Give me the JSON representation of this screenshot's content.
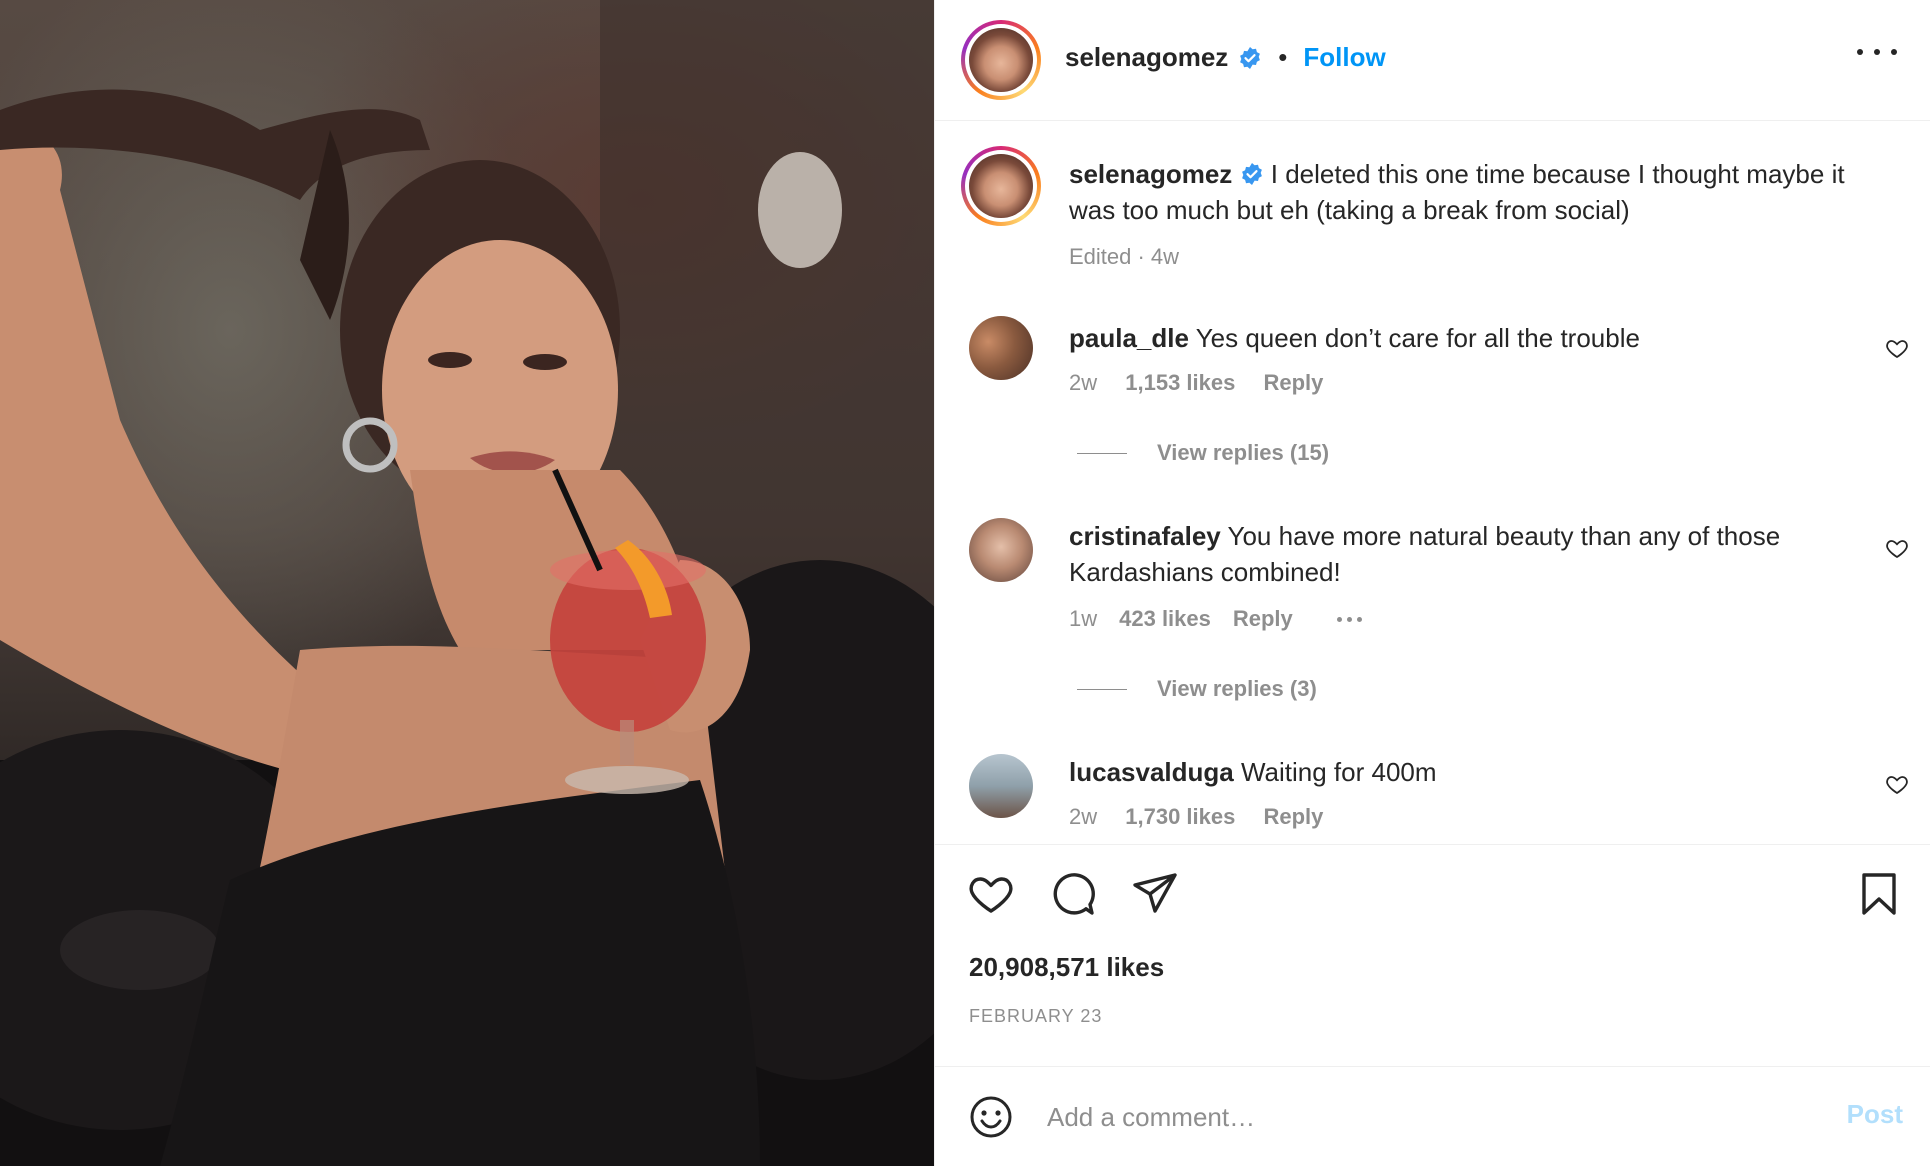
{
  "post": {
    "username": "selenagomez",
    "follow_label": "Follow",
    "separator": "•",
    "caption": "I deleted this one time because I thought maybe it was too much but eh (taking a break from social)",
    "caption_meta": "Edited · 4w"
  },
  "comments": [
    {
      "username": "paula_dle",
      "text": "Yes queen don’t care for all the trouble",
      "time": "2w",
      "likes": "1,153 likes",
      "reply_label": "Reply",
      "view_replies": "View replies (15)"
    },
    {
      "username": "cristinafaley",
      "text": "You have more natural beauty than any of those Kardashians combined!",
      "time": "1w",
      "likes": "423 likes",
      "reply_label": "Reply",
      "view_replies": "View replies (3)"
    },
    {
      "username": "lucasvalduga",
      "text": "Waiting for 400m",
      "time": "2w",
      "likes": "1,730 likes",
      "reply_label": "Reply"
    }
  ],
  "stats": {
    "likes": "20,908,571 likes",
    "date": "FEBRUARY 23"
  },
  "comment_box": {
    "placeholder": "Add a comment…",
    "post_label": "Post"
  },
  "colors": {
    "accent": "#0095f6",
    "muted": "#8e8e8e",
    "text": "#262626",
    "post_disabled": "#b2dffc"
  },
  "icons": [
    "verified-badge-icon",
    "more-options-icon",
    "heart-icon",
    "comment-icon",
    "share-icon",
    "bookmark-icon",
    "emoji-icon"
  ]
}
